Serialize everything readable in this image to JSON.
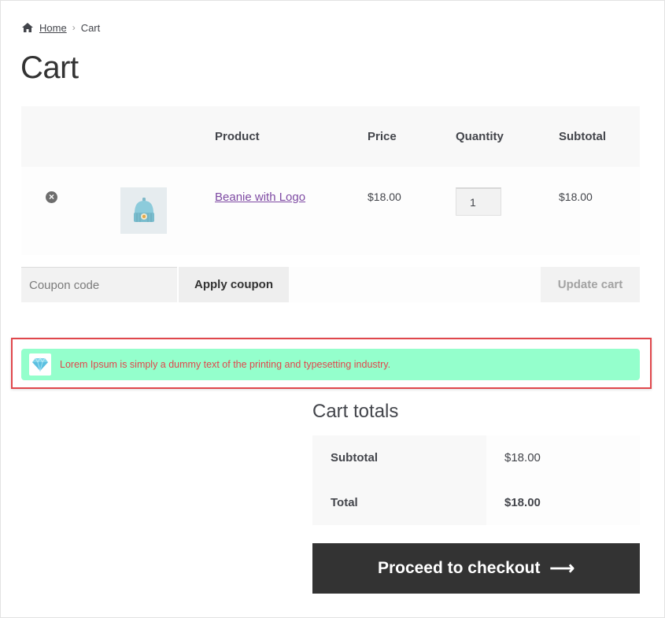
{
  "breadcrumb": {
    "home": "Home",
    "separator": "›",
    "current": "Cart"
  },
  "page_title": "Cart",
  "cart_table": {
    "headers": {
      "product": "Product",
      "price": "Price",
      "quantity": "Quantity",
      "subtotal": "Subtotal"
    },
    "items": [
      {
        "name": "Beanie with Logo",
        "price": "$18.00",
        "quantity": "1",
        "subtotal": "$18.00",
        "remove_glyph": "×"
      }
    ]
  },
  "coupon": {
    "placeholder": "Coupon code",
    "apply_label": "Apply coupon",
    "update_label": "Update cart"
  },
  "notice": {
    "message": "Lorem Ipsum is simply a dummy text of the printing and typesetting industry.",
    "icon": "gem-icon",
    "color": "#e0474c",
    "background": "#94ffcc"
  },
  "totals": {
    "title": "Cart totals",
    "rows": [
      {
        "label": "Subtotal",
        "value": "$18.00"
      },
      {
        "label": "Total",
        "value": "$18.00"
      }
    ]
  },
  "checkout": {
    "label": "Proceed to checkout",
    "arrow": "⟶"
  },
  "colors": {
    "accent_link": "#7e4aa3",
    "button_dark": "#333333",
    "highlight_border": "#e0474c"
  }
}
